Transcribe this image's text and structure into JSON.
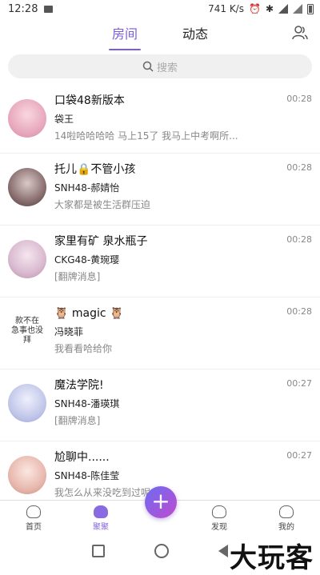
{
  "status": {
    "time": "12:28",
    "network_speed": "741 K/s"
  },
  "tabs": [
    {
      "label": "房间",
      "active": true
    },
    {
      "label": "动态",
      "active": false
    }
  ],
  "search": {
    "placeholder": "搜索"
  },
  "conversations": [
    {
      "title": "口袋48新版本",
      "sender": "袋王",
      "preview": "14啦哈哈哈哈 马上15了 我马上中考啊所...",
      "time": "00:28"
    },
    {
      "title": "托儿🔒不管小孩",
      "sender": "SNH48-郝婧怡",
      "preview": "大家都是被生活群压迫",
      "time": "00:28"
    },
    {
      "title": "家里有矿 泉水瓶子",
      "sender": "CKG48-黄琬璎",
      "preview": "[翻牌消息]",
      "time": "00:28"
    },
    {
      "title": "🦉 magic 🦉",
      "sender": "冯晓菲",
      "preview": "我看看哈给你",
      "time": "00:28",
      "avatar_text": "款不在\n急事也没拜"
    },
    {
      "title": "魔法学院!",
      "sender": "SNH48-潘瑛琪",
      "preview": "[翻牌消息]",
      "time": "00:27"
    },
    {
      "title": "尬聊中......",
      "sender": "SNH48-陈佳莹",
      "preview": "我怎么从来没吃到过呢",
      "time": "00:27"
    }
  ],
  "bottom_nav": [
    {
      "label": "首页",
      "icon": "home-icon",
      "active": false
    },
    {
      "label": "聚聚",
      "icon": "chat-bubble-icon",
      "active": true
    },
    {
      "label": "发现",
      "icon": "discover-icon",
      "active": false
    },
    {
      "label": "我的",
      "icon": "profile-icon",
      "active": false
    }
  ],
  "watermark": "大玩客",
  "colors": {
    "accent": "#7b5ce0",
    "plus_gradient": [
      "#6c6cf0",
      "#c04ad0"
    ]
  }
}
